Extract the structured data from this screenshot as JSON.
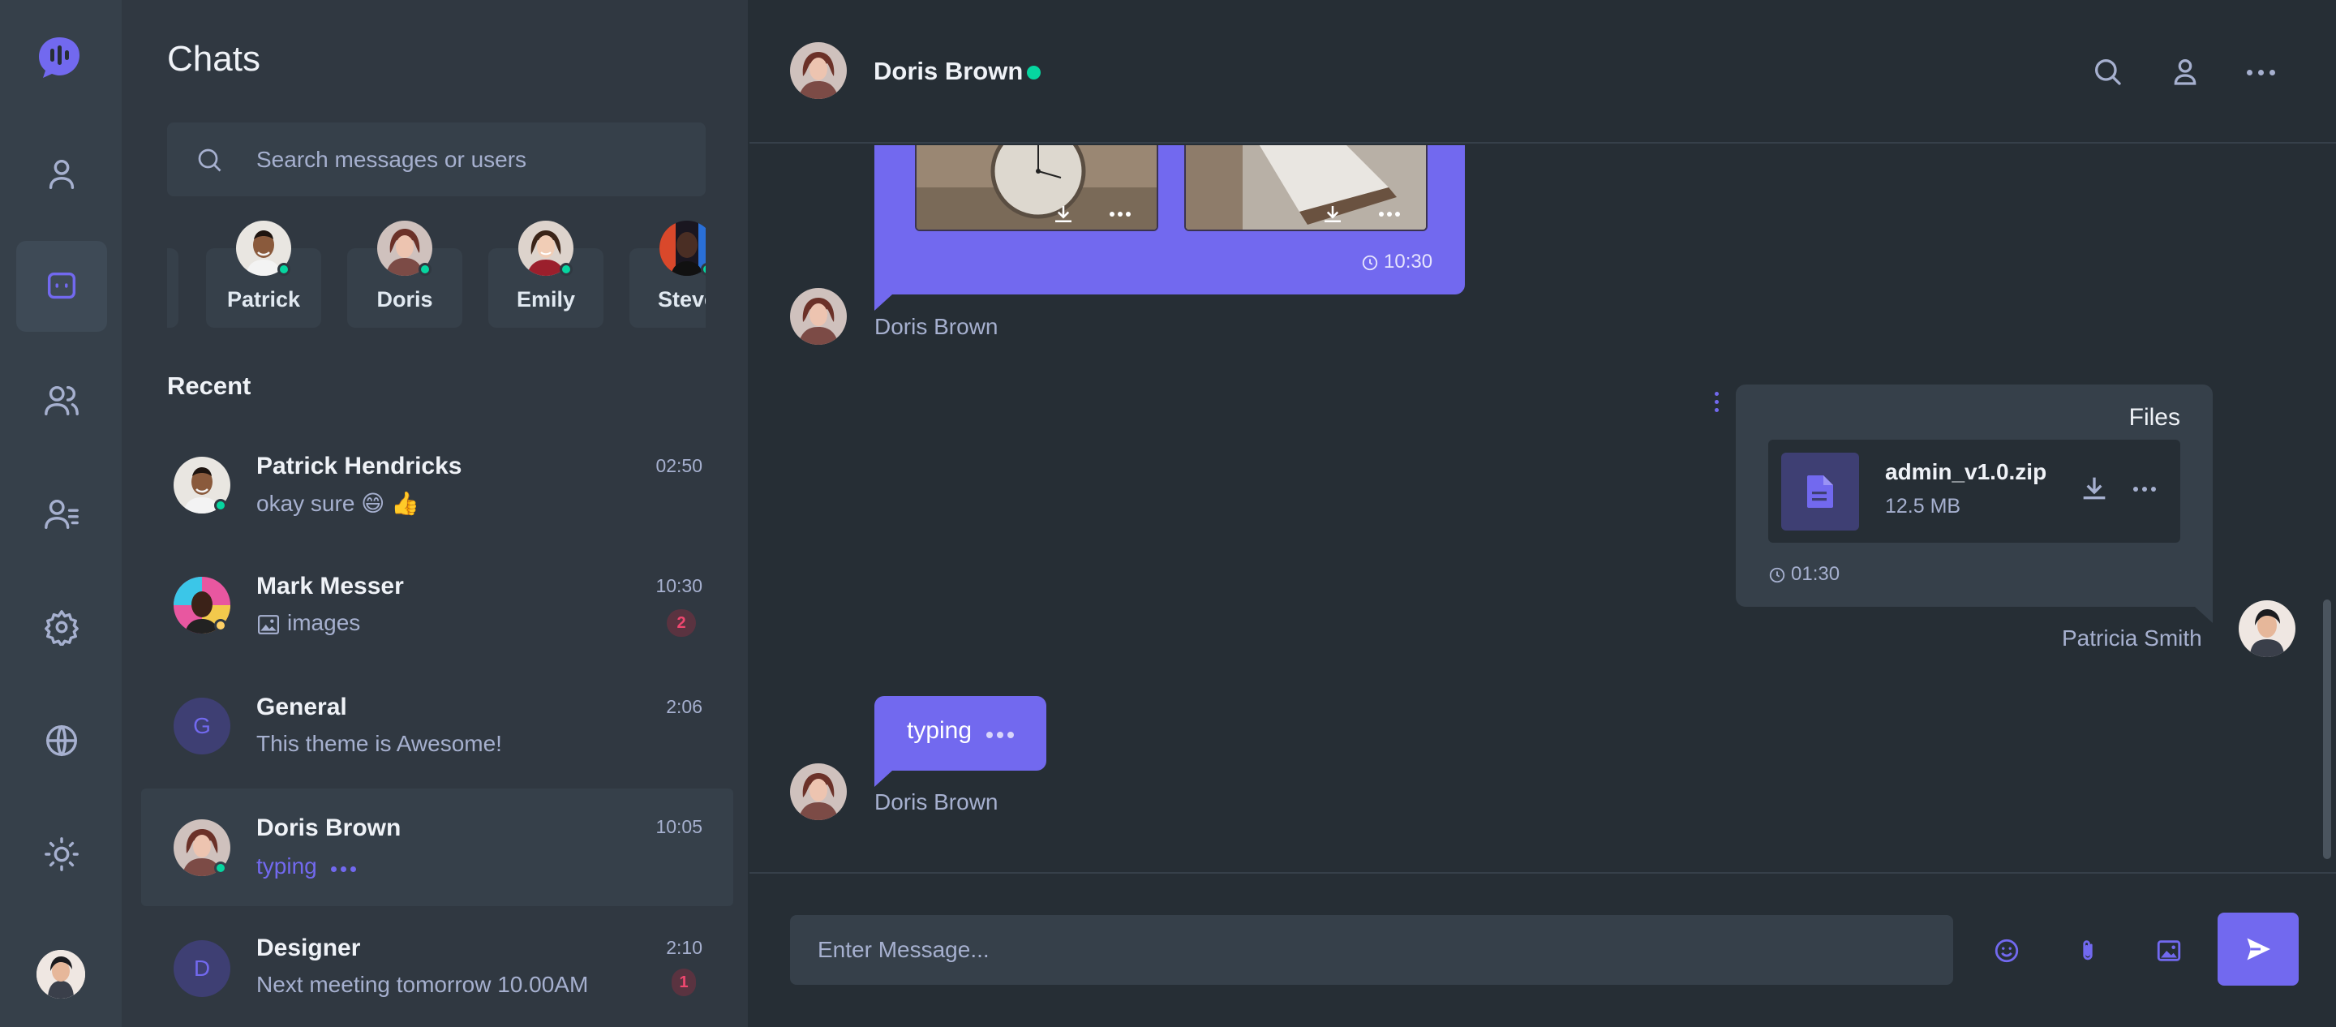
{
  "sidebar": {
    "title": "Chats",
    "search_placeholder": "Search messages or users",
    "recent_label": "Recent"
  },
  "online_users": [
    {
      "name": "Patrick"
    },
    {
      "name": "Doris"
    },
    {
      "name": "Emily"
    },
    {
      "name": "Steve"
    }
  ],
  "recent": [
    {
      "name": "Patrick Hendricks",
      "preview": "okay sure 😄 👍",
      "time": "02:50",
      "badge": "",
      "status": "online"
    },
    {
      "name": "Mark Messer",
      "preview": "images",
      "time": "10:30",
      "badge": "2",
      "status": "away"
    },
    {
      "name": "General",
      "initial": "G",
      "preview": "This theme is Awesome!",
      "time": "2:06",
      "badge": ""
    },
    {
      "name": "Doris Brown",
      "preview": "typing",
      "time": "10:05",
      "badge": "",
      "status": "online"
    },
    {
      "name": "Designer",
      "initial": "D",
      "preview": "Next meeting tomorrow 10.00AM",
      "time": "2:10",
      "badge": "1"
    }
  ],
  "chat_header": {
    "name": "Doris Brown",
    "status": "online"
  },
  "messages": {
    "image_time": "10:30",
    "image_sender": "Doris Brown",
    "file_title": "Files",
    "file_name": "admin_v1.0.zip",
    "file_size": "12.5 MB",
    "file_time": "01:30",
    "file_sender": "Patricia Smith",
    "typing_text": "typing",
    "typing_sender": "Doris Brown"
  },
  "composer": {
    "placeholder": "Enter Message..."
  },
  "colors": {
    "accent": "#7269ef",
    "online": "#06d6a0",
    "away": "#ffd166",
    "badge": "#ef476f"
  }
}
